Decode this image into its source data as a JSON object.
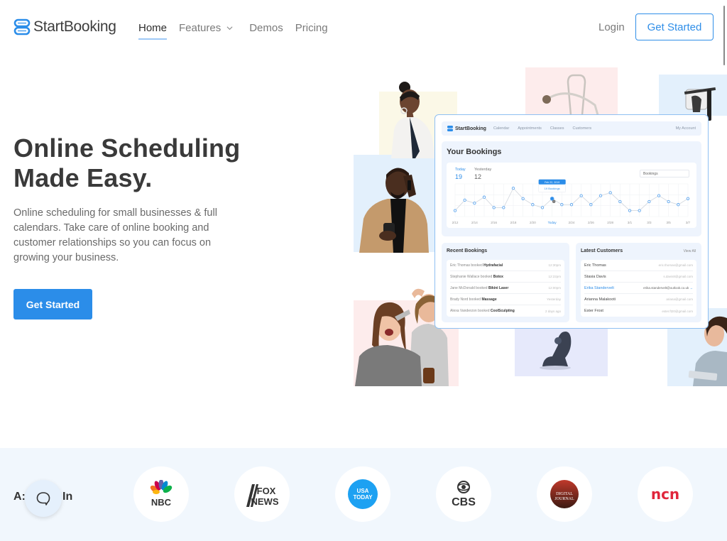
{
  "header": {
    "brand": "StartBooking",
    "nav": [
      {
        "label": "Home",
        "active": true
      },
      {
        "label": "Features",
        "has_dropdown": true
      },
      {
        "label": "Demos"
      },
      {
        "label": "Pricing"
      }
    ],
    "login_label": "Login",
    "cta_label": "Get Started"
  },
  "hero": {
    "title_line1": "Online Scheduling",
    "title_line2": "Made Easy.",
    "description": "Online scheduling for small businesses & full calendars. Take care of online booking and customer relationships so you can focus on growing your business.",
    "cta_label": "Get Started"
  },
  "mockup": {
    "brand": "StartBooking",
    "nav": [
      "Calendar",
      "Appointments",
      "Classes",
      "Customers"
    ],
    "account": "My Account",
    "title": "Your Bookings",
    "today_label": "Today",
    "today_value": "19",
    "yesterday_label": "Yesterday",
    "yesterday_value": "12",
    "select_value": "Bookings",
    "tooltip_date": "Feb 22, 2019",
    "tooltip_value": "19 Bookings",
    "chart_data": {
      "type": "line",
      "x_labels": [
        "2/12",
        "2/14",
        "2/16",
        "2/18",
        "2/20",
        "Today",
        "2/24",
        "2/26",
        "2/28",
        "3/1",
        "3/3",
        "3/5",
        "3/7"
      ],
      "highlight_label": "Today",
      "values": [
        4,
        11,
        9,
        13,
        6,
        6,
        19,
        12,
        8,
        6,
        12,
        8,
        8,
        14,
        8,
        14,
        16,
        10,
        4,
        4,
        10,
        14,
        10,
        8,
        12
      ],
      "highlight_index": 10
    },
    "recent_bookings": {
      "title": "Recent Bookings",
      "rows": [
        {
          "who": "Eric Thomas booked",
          "service": "Hydrafacial",
          "when": "12:30pm"
        },
        {
          "who": "Stephanie Wallace booked",
          "service": "Botox",
          "when": "12:22pm"
        },
        {
          "who": "Jane McDonald booked",
          "service": "Bikini Laser",
          "when": "12:00pm"
        },
        {
          "who": "Brady Nord booked",
          "service": "Massage",
          "when": "Yesterday"
        },
        {
          "who": "Alexa Vanderzon booked",
          "service": "CoolSculpting",
          "when": "2 days ago"
        }
      ]
    },
    "latest_customers": {
      "title": "Latest Customers",
      "view_all": "View All",
      "rows": [
        {
          "name": "Eric Thomas",
          "email": "eric.thomas@gmail.com"
        },
        {
          "name": "Stasia Davis",
          "email": "s.davis8@gmail.com"
        },
        {
          "name": "Erika Standervelt",
          "email": "erika.standervelt@outlook.co.uk",
          "highlighted": true
        },
        {
          "name": "Arianna Malakooti",
          "email": "ariana@gmail.com"
        },
        {
          "name": "Ester Frost",
          "email": "ester.ft20@gmail.com"
        }
      ]
    }
  },
  "press": {
    "label_left": "A:",
    "label_right": "In",
    "logos": [
      {
        "name": "NBC",
        "text": "NBC"
      },
      {
        "name": "Fox News",
        "text_top": "FOX",
        "text_bottom": "NEWS"
      },
      {
        "name": "USA Today",
        "text_top": "USA",
        "text_bottom": "TODAY"
      },
      {
        "name": "CBS",
        "text": "CBS"
      },
      {
        "name": "Digital Journal",
        "text_top": "DIGITAL",
        "text_bottom": "JOURNAL"
      },
      {
        "name": "NCN",
        "text": "ncn"
      }
    ]
  },
  "colors": {
    "accent": "#2b8de9",
    "text_dark": "#3a3a3a",
    "press_bg": "#f1f7fd"
  }
}
